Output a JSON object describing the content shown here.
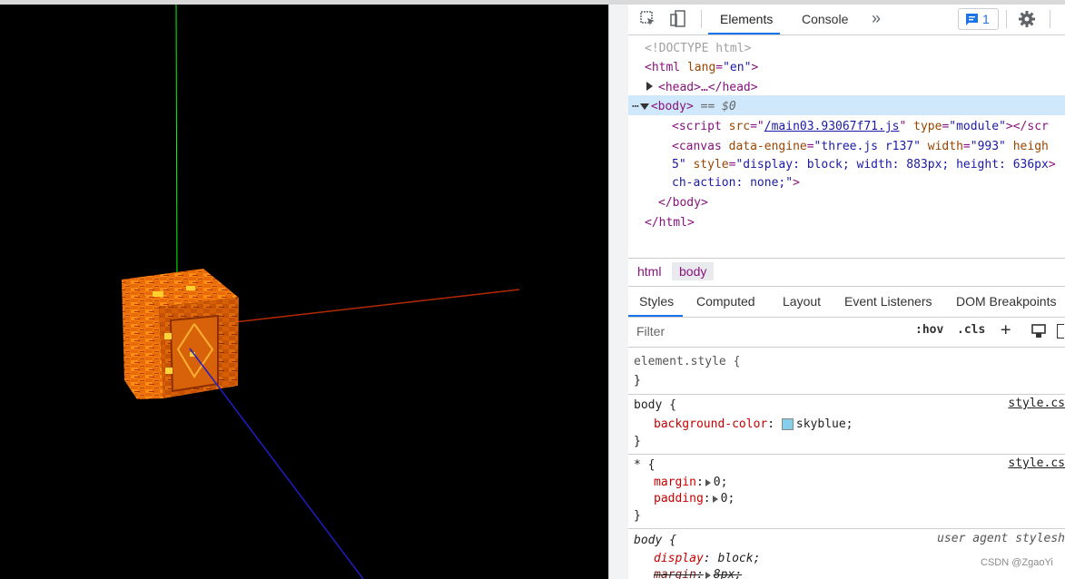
{
  "colors": {
    "viewport_bg": "#000000",
    "y_axis": "#00ff00",
    "x_axis": "#b22a00",
    "z_axis": "#1e1ec8",
    "crate_light": "#ff8a10",
    "crate_dark": "#b83c00",
    "skyblue": "#87ceeb",
    "accent": "#1a73e8"
  },
  "toolbar": {
    "inspect_icon": "inspect-element-icon",
    "device_icon": "device-toolbar-icon",
    "tabs": [
      {
        "label": "Elements",
        "active": true
      },
      {
        "label": "Console",
        "active": false
      }
    ],
    "more_tabs": "»",
    "issues_count": "1",
    "settings_icon": "gear-icon"
  },
  "dom": {
    "doctype": "<!DOCTYPE html>",
    "html_open": "<html",
    "html_attr_name": "lang",
    "html_attr_value": "\"en\"",
    "head_collapsed": "<head>…</head>",
    "body_open": "<body>",
    "body_marker": "== $0",
    "script_attr_src_name": "src",
    "script_src": "/main03.93067f71.js",
    "script_attr_type_name": "type",
    "script_type": "\"module\"",
    "script_close": "></scr",
    "canvas_line1_tag": "<canvas",
    "canvas_engine_name": "data-engine",
    "canvas_engine": "\"three.js r137\"",
    "canvas_width_name": "width",
    "canvas_width": "\"993\"",
    "canvas_height_name": "heigh",
    "canvas_line2_val": "5\"",
    "canvas_style_name": "style",
    "canvas_style_val": "\"display: block; width: 883px; height: 636px",
    "canvas_line2_end": ">",
    "canvas_line3_val": "ch-action: none;\"",
    "canvas_line3_end": ">",
    "body_close": "</body>",
    "html_close": "</html>"
  },
  "breadcrumb": [
    {
      "label": "html",
      "active": false
    },
    {
      "label": "body",
      "active": true
    }
  ],
  "styles_tabs": [
    {
      "label": "Styles",
      "active": true
    },
    {
      "label": "Computed",
      "active": false
    },
    {
      "label": "Layout",
      "active": false
    },
    {
      "label": "Event Listeners",
      "active": false
    },
    {
      "label": "DOM Breakpoints",
      "active": false
    }
  ],
  "filter": {
    "placeholder": "Filter",
    "hov": ":hov",
    "cls": ".cls",
    "add": "+"
  },
  "rules": {
    "element_style": {
      "selector": "element.style {",
      "close": "}"
    },
    "body": {
      "selector": "body {",
      "source": "style.cs",
      "prop": "background-color",
      "value": "skyblue;",
      "close": "}"
    },
    "star": {
      "selector": "* {",
      "source": "style.cs",
      "prop1": "margin",
      "val1": "0;",
      "prop2": "padding",
      "val2": "0;",
      "close": "}"
    },
    "ua_body": {
      "selector": "body {",
      "source": "user agent stylesh",
      "prop1": "display",
      "val1": "block;",
      "prop2": "margin",
      "val2": "8px;"
    }
  },
  "watermark": "CSDN @ZgaoYi"
}
